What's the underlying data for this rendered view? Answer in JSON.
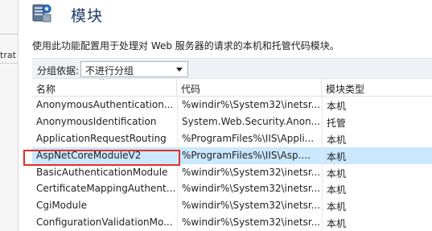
{
  "left_pane": {
    "fragment": "trat"
  },
  "header": {
    "icon": "modules-server-icon",
    "title": "模块"
  },
  "description": "使用此功能配置用于处理对 Web 服务器的请求的本机和托管代码模块。",
  "toolbar": {
    "group_label": "分组依据:",
    "group_value": "不进行分组"
  },
  "grid": {
    "columns": [
      "名称",
      "代码",
      "模块类型"
    ],
    "sort_indicator": "^",
    "rows": [
      {
        "name": "AnonymousAuthentication...",
        "code": "%windir%\\System32\\inetsr...",
        "type": "本机"
      },
      {
        "name": "AnonymousIdentification",
        "code": "System.Web.Security.Anon...",
        "type": "托管"
      },
      {
        "name": "ApplicationRequestRouting",
        "code": "%ProgramFiles%\\IIS\\Appli...",
        "type": "本机"
      },
      {
        "name": "AspNetCoreModuleV2",
        "code": "%ProgramFiles%\\IIS\\Asp....",
        "type": "本机",
        "selected": true
      },
      {
        "name": "BasicAuthenticationModule",
        "code": "%windir%\\System32\\inetsr...",
        "type": "本机"
      },
      {
        "name": "CertificateMappingAuthenti...",
        "code": "%windir%\\System32\\inetsr...",
        "type": "本机"
      },
      {
        "name": "CgiModule",
        "code": "%windir%\\System32\\inetsr...",
        "type": "本机"
      },
      {
        "name": "ConfigurationValidationMo...",
        "code": "%windir%\\System32\\inetsr...",
        "type": "本机"
      }
    ]
  },
  "colors": {
    "selected_row": "#cce8ff",
    "highlight_border": "#e0302b",
    "title": "#1e3a6b"
  }
}
